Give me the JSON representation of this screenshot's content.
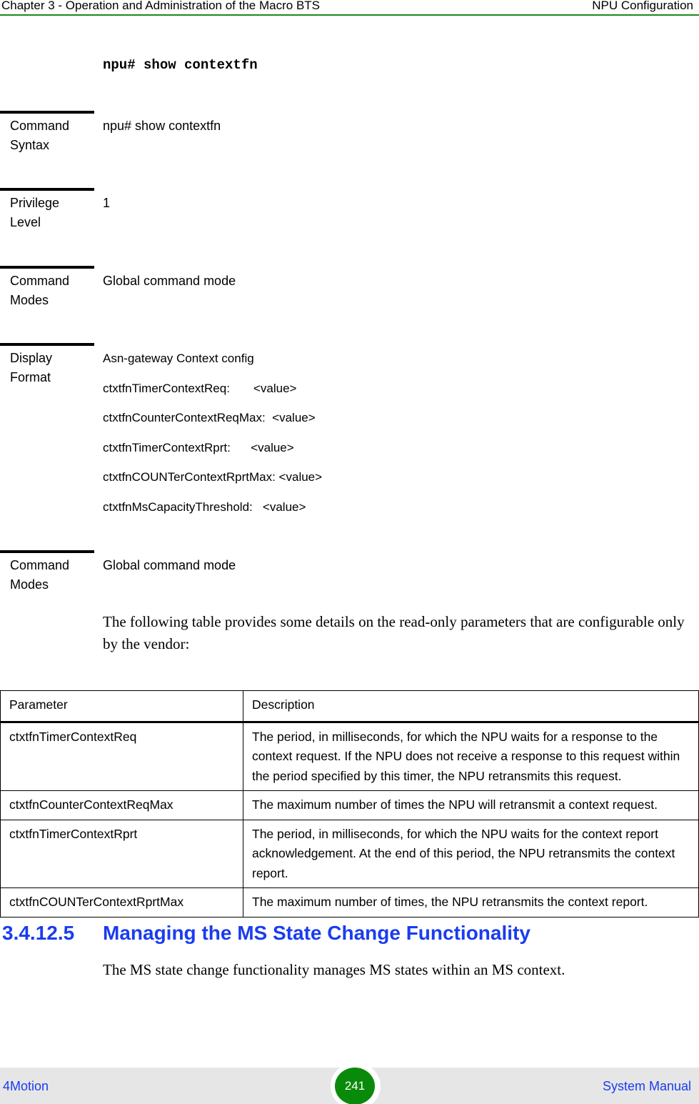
{
  "header": {
    "chapter": "Chapter 3 - Operation and Administration of the Macro BTS",
    "section": "NPU Configuration"
  },
  "command_title": "npu# show contextfn",
  "blocks": [
    {
      "label": "Command Syntax",
      "value": "npu# show contextfn"
    },
    {
      "label": "Privilege Level",
      "value": "1"
    },
    {
      "label": "Command Modes",
      "value": "Global command mode"
    },
    {
      "label": "Display Format",
      "lines": [
        "Asn-gateway Context config",
        "ctxtfnTimerContextReq:       <value>",
        "ctxtfnCounterContextReqMax:  <value>",
        "ctxtfnTimerContextRprt:      <value>",
        "ctxtfnCOUNTerContextRprtMax: <value>",
        "ctxtfnMsCapacityThreshold:   <value>"
      ]
    },
    {
      "label": "Command Modes",
      "value": "Global command mode"
    }
  ],
  "intro_paragraph": "The following table provides some details on the read-only parameters that are configurable only by the vendor:",
  "table": {
    "headers": [
      "Parameter",
      "Description"
    ],
    "rows": [
      [
        "ctxtfnTimerContextReq",
        "The period, in milliseconds, for which the NPU waits for a response to the context request. If the NPU does not receive a response to this request within the period specified by this timer, the NPU retransmits this request."
      ],
      [
        "ctxtfnCounterContextReqMax",
        "The maximum number of times the NPU will retransmit a context request."
      ],
      [
        "ctxtfnTimerContextRprt",
        "The period, in milliseconds, for which the NPU waits for the context report acknowledgement. At the end of this period, the NPU retransmits the context report."
      ],
      [
        "ctxtfnCOUNTerContextRprtMax",
        "The maximum number of times, the NPU retransmits the context report."
      ]
    ]
  },
  "section": {
    "number": "3.4.12.5",
    "title": "Managing the MS State Change Functionality",
    "paragraph": "The MS state change functionality manages MS states within an MS context."
  },
  "footer": {
    "left": "4Motion",
    "page_number": "241",
    "right": "System Manual"
  },
  "colors": {
    "header_rule": "#1a8a1a",
    "heading_blue": "#1a3cf0",
    "page_badge": "#0a8a0a",
    "footer_bg": "#e6e6e6"
  }
}
